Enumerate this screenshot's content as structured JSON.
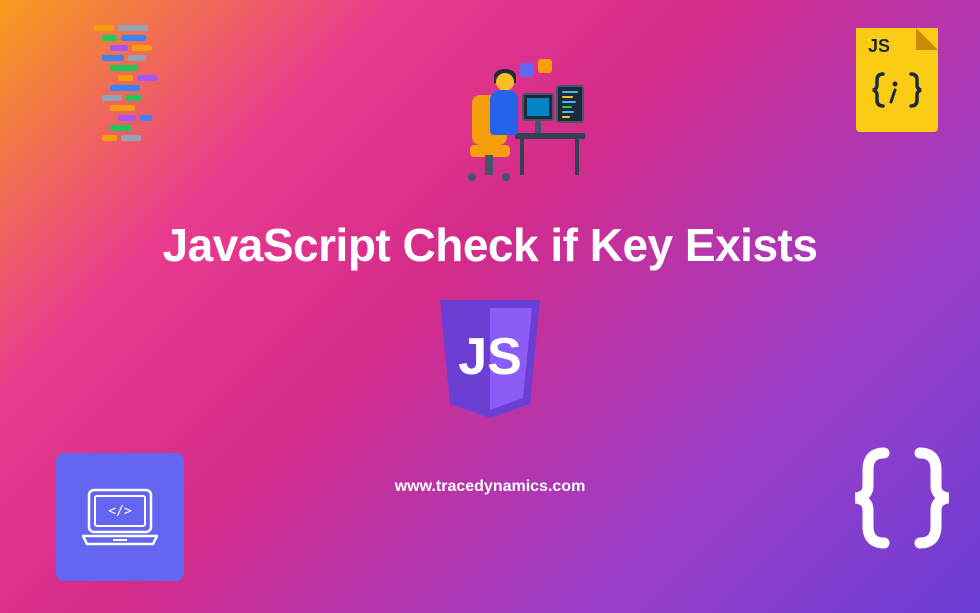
{
  "title": "JavaScript Check if Key Exists",
  "url": "www.tracedynamics.com",
  "jsfile": {
    "label": "JS",
    "braces_glyph": "{;}"
  },
  "jsshield": {
    "label": "JS"
  },
  "braces": {
    "glyph": "{ }"
  }
}
